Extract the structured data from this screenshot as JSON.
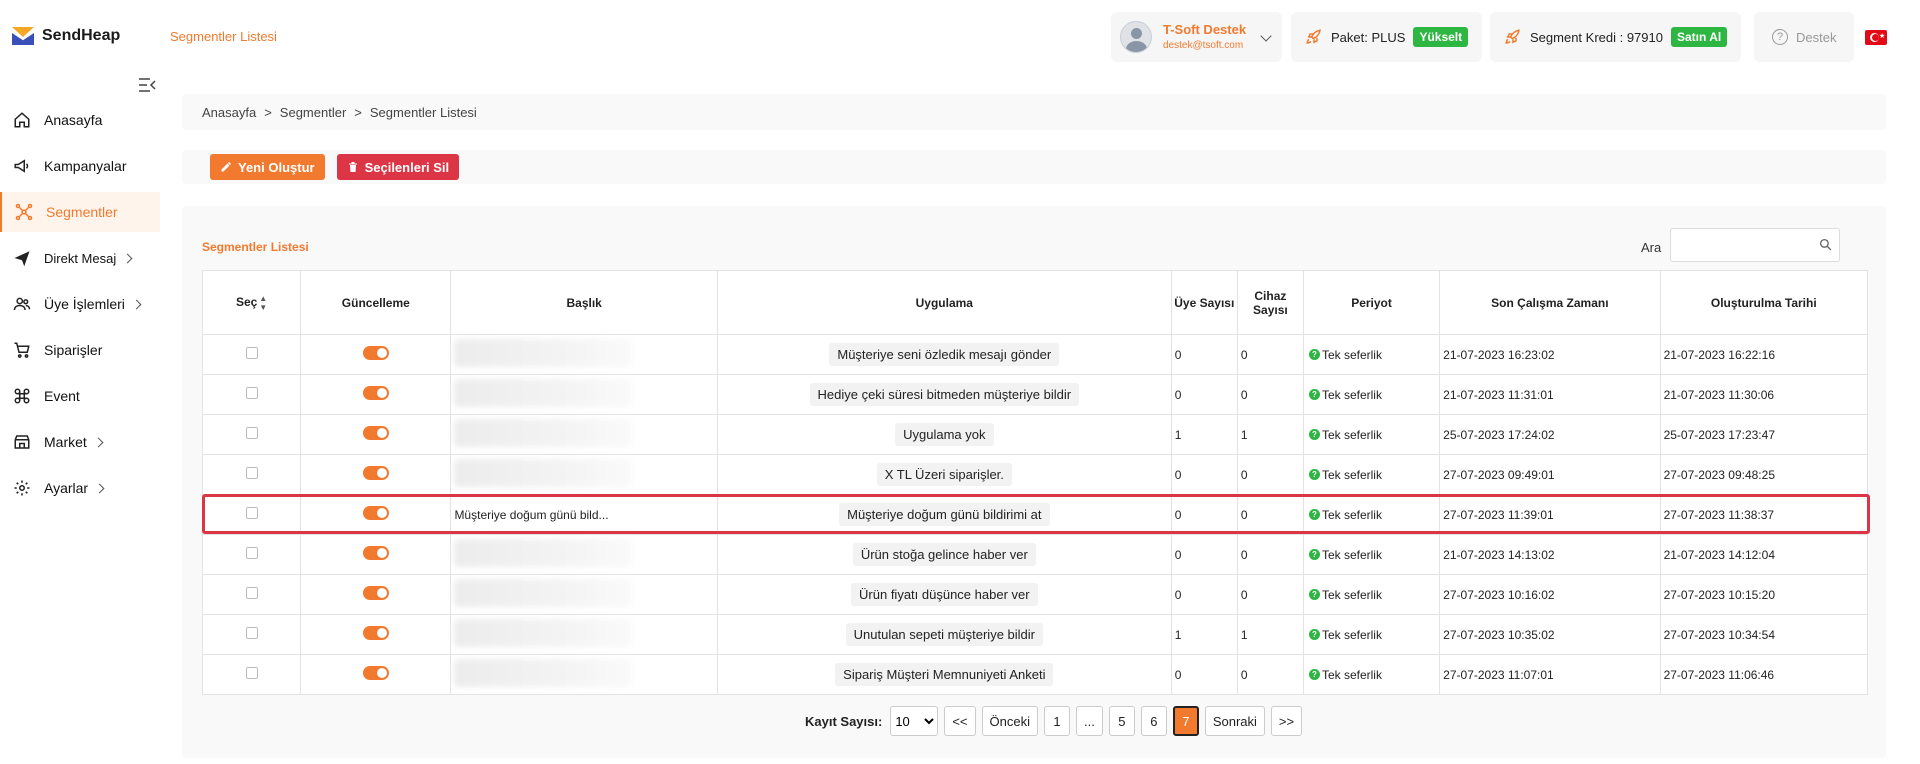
{
  "header": {
    "brand": "SendHeap",
    "page_title": "Segmentler Listesi",
    "user_name": "T-Soft Destek",
    "user_email": "destek@tsoft.com",
    "package_label": "Paket: PLUS",
    "upgrade_label": "Yükselt",
    "credit_label": "Segment Kredi : 97910",
    "buy_label": "Satın Al",
    "support_label": "Destek"
  },
  "sidebar": {
    "items": [
      {
        "label": "Anasayfa",
        "icon": "home-icon"
      },
      {
        "label": "Kampanyalar",
        "icon": "megaphone-icon"
      },
      {
        "label": "Segmentler",
        "icon": "segments-icon"
      },
      {
        "label": "Direkt Mesaj",
        "icon": "send-icon"
      },
      {
        "label": "Üye İşlemleri",
        "icon": "users-icon"
      },
      {
        "label": "Siparişler",
        "icon": "cart-icon"
      },
      {
        "label": "Event",
        "icon": "command-icon"
      },
      {
        "label": "Market",
        "icon": "store-icon"
      },
      {
        "label": "Ayarlar",
        "icon": "gear-icon"
      }
    ]
  },
  "breadcrumb": {
    "items": [
      "Anasayfa",
      "Segmentler",
      "Segmentler Listesi"
    ],
    "separator": ">"
  },
  "toolbar": {
    "new_label": "Yeni Oluştur",
    "delete_label": "Seçilenleri Sil"
  },
  "table": {
    "title": "Segmentler Listesi",
    "search_label": "Ara",
    "columns": {
      "select": "Seç",
      "update": "Güncelleme",
      "title": "Başlık",
      "app": "Uygulama",
      "members": "Üye Sayısı",
      "devices": "Cihaz Sayısı",
      "period": "Periyot",
      "last_run": "Son Çalışma Zamanı",
      "created": "Oluşturulma Tarihi"
    },
    "rows": [
      {
        "title": "",
        "app": "Müşteriye seni özledik mesajı gönder",
        "members": "0",
        "devices": "0",
        "period": "Tek seferlik",
        "last_run": "21-07-2023 16:23:02",
        "created": "21-07-2023 16:22:16"
      },
      {
        "title": "",
        "app": "Hediye çeki süresi bitmeden müşteriye bildir",
        "members": "0",
        "devices": "0",
        "period": "Tek seferlik",
        "last_run": "21-07-2023 11:31:01",
        "created": "21-07-2023 11:30:06"
      },
      {
        "title": "",
        "app": "Uygulama yok",
        "members": "1",
        "devices": "1",
        "period": "Tek seferlik",
        "last_run": "25-07-2023 17:24:02",
        "created": "25-07-2023 17:23:47"
      },
      {
        "title": "",
        "app": "X TL Üzeri siparişler.",
        "members": "0",
        "devices": "0",
        "period": "Tek seferlik",
        "last_run": "27-07-2023 09:49:01",
        "created": "27-07-2023 09:48:25"
      },
      {
        "title": "Müşteriye doğum günü bild...",
        "app": "Müşteriye doğum günü bildirimi at",
        "members": "0",
        "devices": "0",
        "period": "Tek seferlik",
        "last_run": "27-07-2023 11:39:01",
        "created": "27-07-2023 11:38:37"
      },
      {
        "title": "",
        "app": "Ürün stoğa gelince haber ver",
        "members": "0",
        "devices": "0",
        "period": "Tek seferlik",
        "last_run": "21-07-2023 14:13:02",
        "created": "21-07-2023 14:12:04"
      },
      {
        "title": "",
        "app": "Ürün fiyatı düşünce haber ver",
        "members": "0",
        "devices": "0",
        "period": "Tek seferlik",
        "last_run": "27-07-2023 10:16:02",
        "created": "27-07-2023 10:15:20"
      },
      {
        "title": "",
        "app": "Unutulan sepeti müşteriye bildir",
        "members": "1",
        "devices": "1",
        "period": "Tek seferlik",
        "last_run": "27-07-2023 10:35:02",
        "created": "27-07-2023 10:34:54"
      },
      {
        "title": "",
        "app": "Sipariş Müşteri Memnuniyeti Anketi",
        "members": "0",
        "devices": "0",
        "period": "Tek seferlik",
        "last_run": "27-07-2023 11:07:01",
        "created": "27-07-2023 11:06:46"
      }
    ]
  },
  "pagination": {
    "records_label": "Kayıt Sayısı:",
    "page_size": "10",
    "first": "<<",
    "prev": "Önceki",
    "pages": [
      "1",
      "...",
      "5",
      "6",
      "7"
    ],
    "current": "7",
    "next": "Sonraki",
    "last": ">>"
  },
  "colors": {
    "accent": "#f27a2e",
    "danger": "#dc3545",
    "success": "#2db742"
  }
}
